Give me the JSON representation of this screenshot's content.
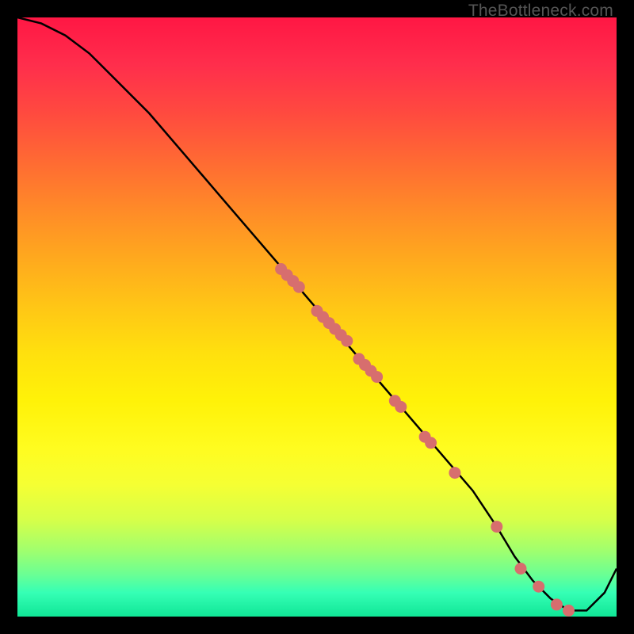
{
  "watermark": "TheBottleneck.com",
  "chart_data": {
    "type": "line",
    "title": "",
    "xlabel": "",
    "ylabel": "",
    "xlim": [
      0,
      100
    ],
    "ylim": [
      0,
      100
    ],
    "background": "rainbow-gradient-red-to-green",
    "series": [
      {
        "name": "bottleneck-curve",
        "x": [
          0,
          4,
          8,
          12,
          16,
          22,
          28,
          34,
          40,
          46,
          52,
          58,
          64,
          70,
          76,
          80,
          83,
          86,
          89,
          92,
          95,
          98,
          100
        ],
        "values": [
          100,
          99,
          97,
          94,
          90,
          84,
          77,
          70,
          63,
          56,
          49,
          42,
          35,
          28,
          21,
          15,
          10,
          6,
          3,
          1,
          1,
          4,
          8
        ]
      }
    ],
    "markers": [
      {
        "x": 44,
        "y": 58
      },
      {
        "x": 45,
        "y": 57
      },
      {
        "x": 46,
        "y": 56
      },
      {
        "x": 47,
        "y": 55
      },
      {
        "x": 50,
        "y": 51
      },
      {
        "x": 51,
        "y": 50
      },
      {
        "x": 52,
        "y": 49
      },
      {
        "x": 53,
        "y": 48
      },
      {
        "x": 54,
        "y": 47
      },
      {
        "x": 55,
        "y": 46
      },
      {
        "x": 57,
        "y": 43
      },
      {
        "x": 58,
        "y": 42
      },
      {
        "x": 59,
        "y": 41
      },
      {
        "x": 60,
        "y": 40
      },
      {
        "x": 63,
        "y": 36
      },
      {
        "x": 64,
        "y": 35
      },
      {
        "x": 68,
        "y": 30
      },
      {
        "x": 69,
        "y": 29
      },
      {
        "x": 73,
        "y": 24
      },
      {
        "x": 80,
        "y": 15
      },
      {
        "x": 84,
        "y": 8
      },
      {
        "x": 87,
        "y": 5
      },
      {
        "x": 90,
        "y": 2
      },
      {
        "x": 92,
        "y": 1
      }
    ],
    "colors": {
      "curve": "#000000",
      "marker_fill": "#d76e6e",
      "marker_stroke": "#c85a5a"
    }
  }
}
